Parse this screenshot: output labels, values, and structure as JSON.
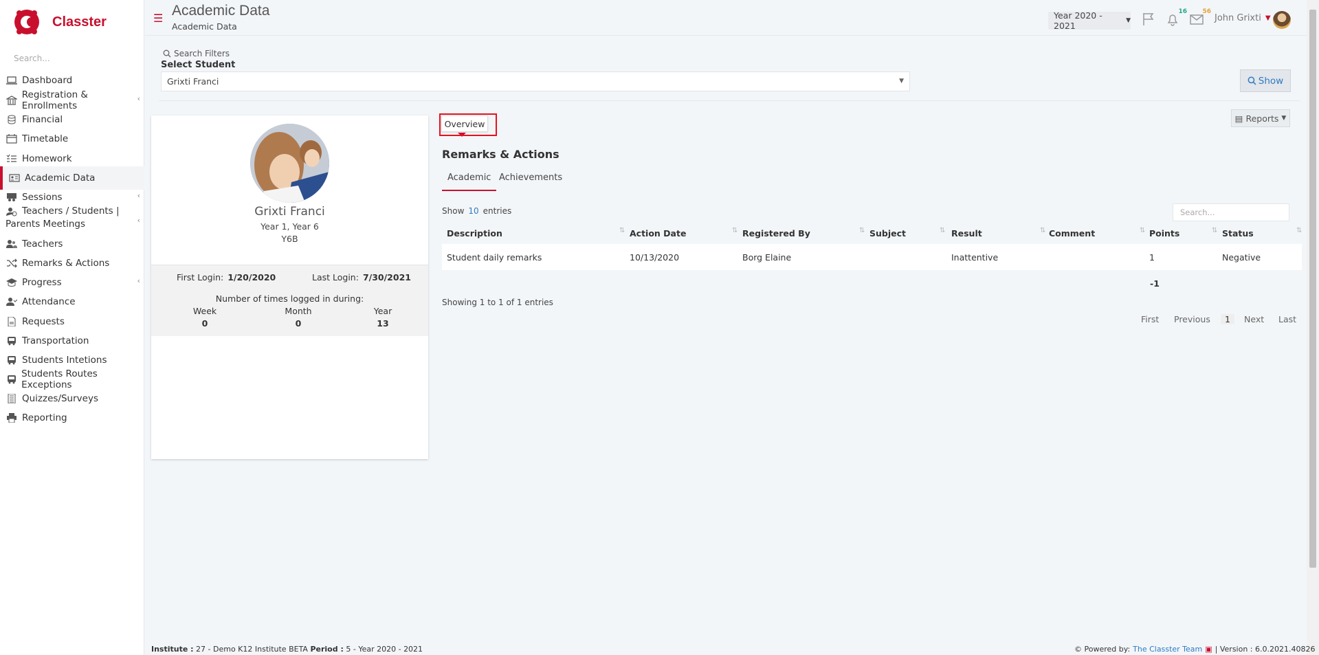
{
  "app": {
    "name": "Classter",
    "brand_color": "#c8102e"
  },
  "sidebar": {
    "search_placeholder": "Search...",
    "items": [
      {
        "label": "Dashboard",
        "icon": "laptop-icon",
        "chevron": false
      },
      {
        "label": "Registration & Enrollments",
        "icon": "bank-icon",
        "chevron": true
      },
      {
        "label": "Financial",
        "icon": "coins-icon",
        "chevron": false
      },
      {
        "label": "Timetable",
        "icon": "calendar-icon",
        "chevron": false
      },
      {
        "label": "Homework",
        "icon": "list-check-icon",
        "chevron": false
      },
      {
        "label": "Academic Data",
        "icon": "id-card-icon",
        "chevron": false,
        "active": true
      },
      {
        "label": "Sessions",
        "icon": "users-session-icon",
        "chevron": true
      },
      {
        "label": "Teachers / Students | Parents Meetings",
        "icon": "user-clock-icon",
        "chevron": true
      },
      {
        "label": "Teachers",
        "icon": "users-icon",
        "chevron": false
      },
      {
        "label": "Remarks & Actions",
        "icon": "shuffle-icon",
        "chevron": false
      },
      {
        "label": "Progress",
        "icon": "graduation-cap-icon",
        "chevron": true
      },
      {
        "label": "Attendance",
        "icon": "user-check-icon",
        "chevron": false
      },
      {
        "label": "Requests",
        "icon": "document-icon",
        "chevron": false
      },
      {
        "label": "Transportation",
        "icon": "bus-icon",
        "chevron": false
      },
      {
        "label": "Students Intetions",
        "icon": "bus-icon",
        "chevron": false
      },
      {
        "label": "Students Routes Exceptions",
        "icon": "bus-icon",
        "chevron": false
      },
      {
        "label": "Quizzes/Surveys",
        "icon": "checklist-icon",
        "chevron": false
      },
      {
        "label": "Reporting",
        "icon": "printer-icon",
        "chevron": false
      }
    ]
  },
  "header": {
    "title": "Academic Data",
    "breadcrumb": "Academic Data",
    "year": "Year 2020 - 2021",
    "notifications_count": "16",
    "messages_count": "56",
    "user": "John Grixti"
  },
  "filters": {
    "label": "Search Filters",
    "select_label": "Select Student",
    "student_value": "Grixti Franci",
    "show_button": "Show"
  },
  "profile": {
    "name": "Grixti Franci",
    "year": "Year 1, Year 6",
    "class": "Y6B",
    "first_login_label": "First Login:",
    "first_login": "1/20/2020",
    "last_login_label": "Last Login:",
    "last_login": "7/30/2021",
    "times_label": "Number of times logged in during:",
    "periods": [
      {
        "label": "Week",
        "value": "0"
      },
      {
        "label": "Month",
        "value": "0"
      },
      {
        "label": "Year",
        "value": "13"
      }
    ]
  },
  "main": {
    "overview_tab": "Overview",
    "reports_button": "Reports",
    "section_title": "Remarks & Actions",
    "subtabs": [
      "Academic",
      "Achievements"
    ],
    "show_prefix": "Show",
    "show_count": "10",
    "show_suffix": "entries",
    "search_placeholder": "Search...",
    "columns": [
      "Description",
      "Action Date",
      "Registered By",
      "Subject",
      "Result",
      "Comment",
      "Points",
      "Status"
    ],
    "rows": [
      {
        "description": "Student daily remarks",
        "action_date": "10/13/2020",
        "registered_by": "Borg Elaine",
        "subject": "",
        "result": "Inattentive",
        "comment": "",
        "points": "1",
        "status": "Negative"
      }
    ],
    "points_total": "-1",
    "showing": "Showing 1 to 1 of 1 entries",
    "pagination": {
      "first": "First",
      "previous": "Previous",
      "current": "1",
      "next": "Next",
      "last": "Last"
    }
  },
  "footer": {
    "institute_label": "Institute :",
    "institute": "27 - Demo K12 Institute BETA",
    "period_label": "Period :",
    "period": "5 - Year 2020 - 2021",
    "powered_label": "Powered by:",
    "powered_link": "The Classter Team",
    "version": "| Version : 6.0.2021.40826"
  }
}
